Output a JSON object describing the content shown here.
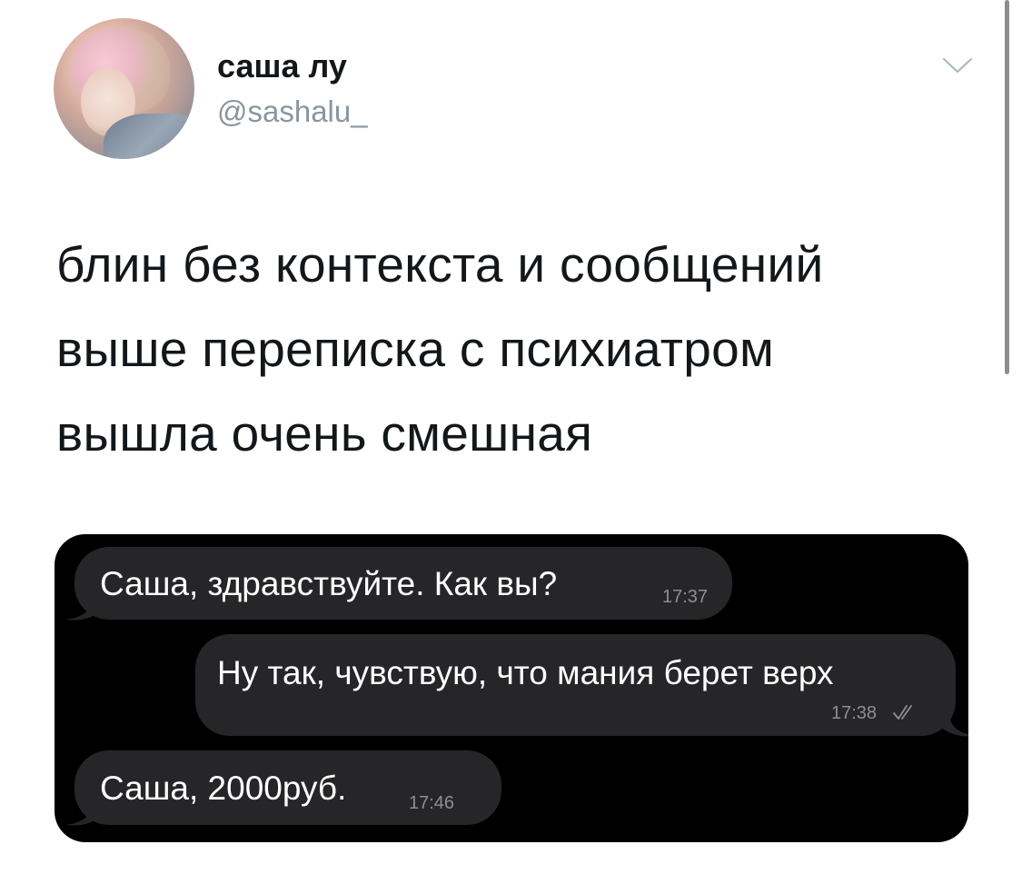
{
  "author": {
    "name": "саша лу",
    "handle": "@sashalu_"
  },
  "tweet": {
    "lines": [
      "блин без контекста и сообщений",
      "выше переписка с психиатром",
      "вышла очень смешная"
    ]
  },
  "chat": {
    "messages": [
      {
        "direction": "incoming",
        "text": "Саша, здравствуйте. Как вы?",
        "time": "17:37"
      },
      {
        "direction": "outgoing",
        "text": "Ну так, чувствую, что мания берет верх",
        "time": "17:38",
        "status": "read-double-check"
      },
      {
        "direction": "incoming",
        "text": "Саша, 2000руб.",
        "time": "17:46"
      }
    ]
  },
  "icons": {
    "menu": "chevron-down-icon",
    "read_status": "double-check-icon"
  },
  "colors": {
    "name": "#14171a",
    "handle": "#8a959e",
    "chat_background": "#000000",
    "bubble": "#262628",
    "timestamp": "#8e8e93"
  }
}
